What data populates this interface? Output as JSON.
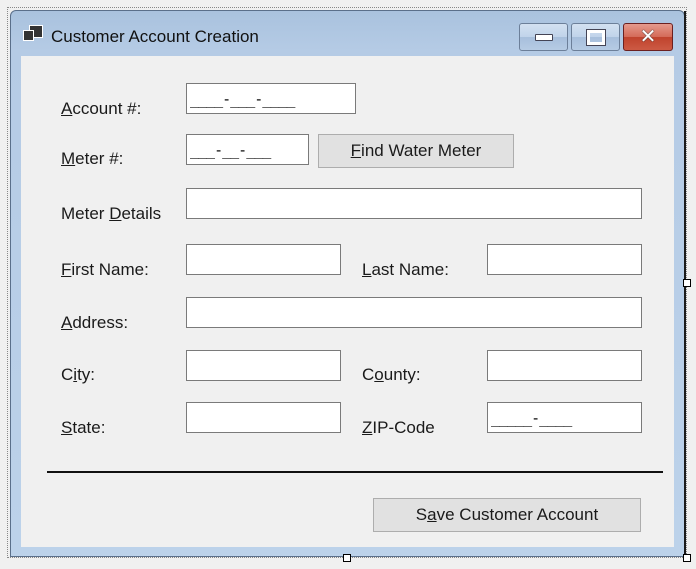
{
  "window": {
    "title": "Customer Account Creation",
    "app_icon": "window-app-icon",
    "caption_buttons": {
      "minimize": "minimize-icon",
      "maximize": "maximize-icon",
      "close": "close-icon",
      "close_glyph": "✕"
    }
  },
  "form": {
    "account": {
      "label_key": "A",
      "label_rest": "ccount #:",
      "mask": "____-___-____"
    },
    "meter": {
      "label_key": "M",
      "label_rest": "eter #:",
      "mask": "___-__-___"
    },
    "find_button": {
      "key": "F",
      "rest": "ind Water Meter"
    },
    "meter_details": {
      "label_pre": "Meter ",
      "label_key": "D",
      "label_rest": "etails",
      "value": ""
    },
    "first_name": {
      "label_key": "F",
      "label_rest": "irst Name:",
      "value": ""
    },
    "last_name": {
      "label_key": "L",
      "label_rest": "ast Name:",
      "value": ""
    },
    "address": {
      "label_key": "A",
      "label_rest": "ddress:",
      "value": ""
    },
    "city": {
      "label_pre": "C",
      "label_key": "i",
      "label_rest": "ty:",
      "value": ""
    },
    "county": {
      "label_pre": "C",
      "label_key": "o",
      "label_rest": "unty:",
      "value": ""
    },
    "state": {
      "label_key": "S",
      "label_rest": "tate:",
      "value": ""
    },
    "zip": {
      "label_key": "Z",
      "label_rest": "IP-Code",
      "mask": "_____-____"
    },
    "save_button": {
      "pre": "S",
      "key": "a",
      "rest": "ve Customer Account"
    }
  }
}
